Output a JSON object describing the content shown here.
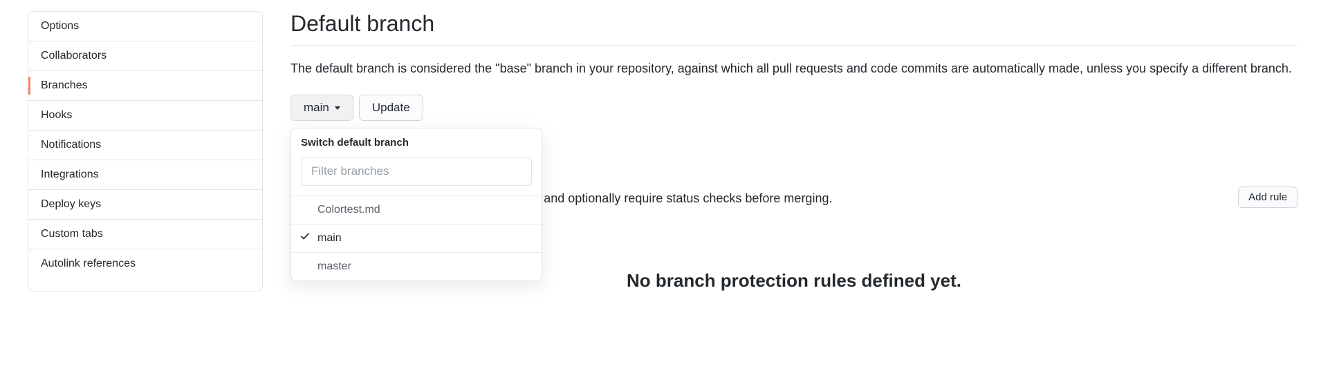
{
  "sidebar": {
    "items": [
      {
        "label": "Options",
        "active": false
      },
      {
        "label": "Collaborators",
        "active": false
      },
      {
        "label": "Branches",
        "active": true
      },
      {
        "label": "Hooks",
        "active": false
      },
      {
        "label": "Notifications",
        "active": false
      },
      {
        "label": "Integrations",
        "active": false
      },
      {
        "label": "Deploy keys",
        "active": false
      },
      {
        "label": "Custom tabs",
        "active": false
      },
      {
        "label": "Autolink references",
        "active": false
      }
    ]
  },
  "main": {
    "title": "Default branch",
    "description": "The default branch is considered the \"base\" branch in your repository, against which all pull requests and code commits are automatically made, unless you specify a different branch.",
    "branch_selector": {
      "current": "main",
      "update_label": "Update"
    },
    "dropdown": {
      "header": "Switch default branch",
      "filter_placeholder": "Filter branches",
      "items": [
        {
          "label": "Colortest.md",
          "selected": false
        },
        {
          "label": "main",
          "selected": true
        },
        {
          "label": "master",
          "selected": false
        }
      ]
    },
    "protection": {
      "description_fragment": "ushing, prevent branches from being deleted, and optionally require status checks before merging.",
      "add_rule_label": "Add rule",
      "no_rules": "No branch protection rules defined yet."
    }
  }
}
